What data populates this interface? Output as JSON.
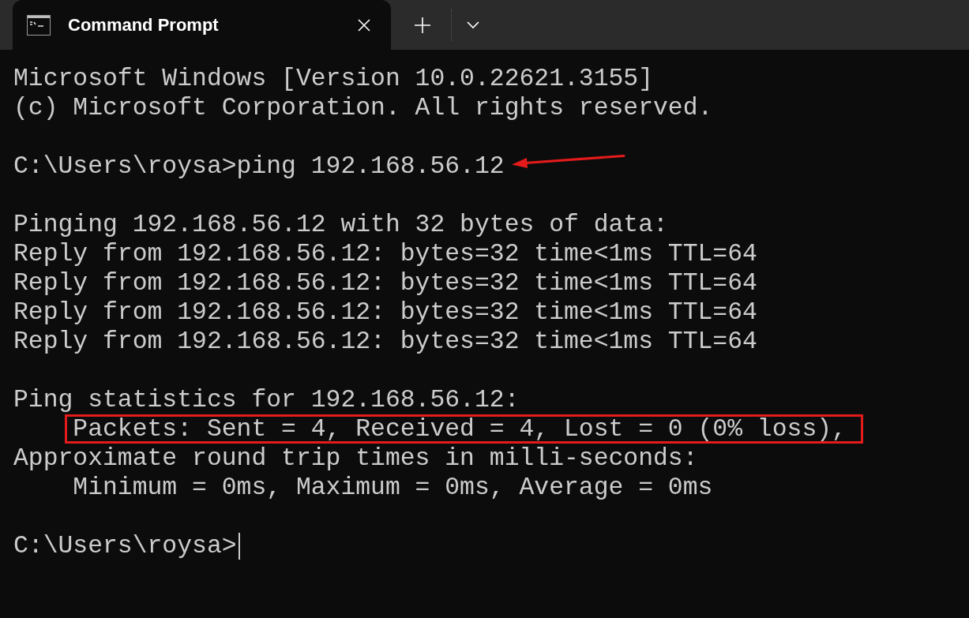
{
  "tabs": [
    {
      "title": "Command Prompt",
      "selected": true
    }
  ],
  "terminal": {
    "lines": [
      {
        "kind": "output",
        "text": "Microsoft Windows [Version 10.0.22621.3155]"
      },
      {
        "kind": "output",
        "text": "(c) Microsoft Corporation. All rights reserved."
      },
      {
        "kind": "blank"
      },
      {
        "kind": "output",
        "text": "C:\\Users\\roysa>ping 192.168.56.12",
        "arrow": true
      },
      {
        "kind": "blank"
      },
      {
        "kind": "output",
        "text": "Pinging 192.168.56.12 with 32 bytes of data:"
      },
      {
        "kind": "output",
        "text": "Reply from 192.168.56.12: bytes=32 time<1ms TTL=64"
      },
      {
        "kind": "output",
        "text": "Reply from 192.168.56.12: bytes=32 time<1ms TTL=64"
      },
      {
        "kind": "output",
        "text": "Reply from 192.168.56.12: bytes=32 time<1ms TTL=64"
      },
      {
        "kind": "output",
        "text": "Reply from 192.168.56.12: bytes=32 time<1ms TTL=64"
      },
      {
        "kind": "blank"
      },
      {
        "kind": "output",
        "text": "Ping statistics for 192.168.56.12:"
      },
      {
        "kind": "output",
        "text": "    Packets: Sent = 4, Received = 4, Lost = 0 (0% loss),",
        "highlighted": true
      },
      {
        "kind": "output",
        "text": "Approximate round trip times in milli-seconds:"
      },
      {
        "kind": "output",
        "text": "    Minimum = 0ms, Maximum = 0ms, Average = 0ms"
      },
      {
        "kind": "blank"
      },
      {
        "kind": "output",
        "text": "C:\\Users\\roysa>",
        "cursor": true
      }
    ]
  }
}
